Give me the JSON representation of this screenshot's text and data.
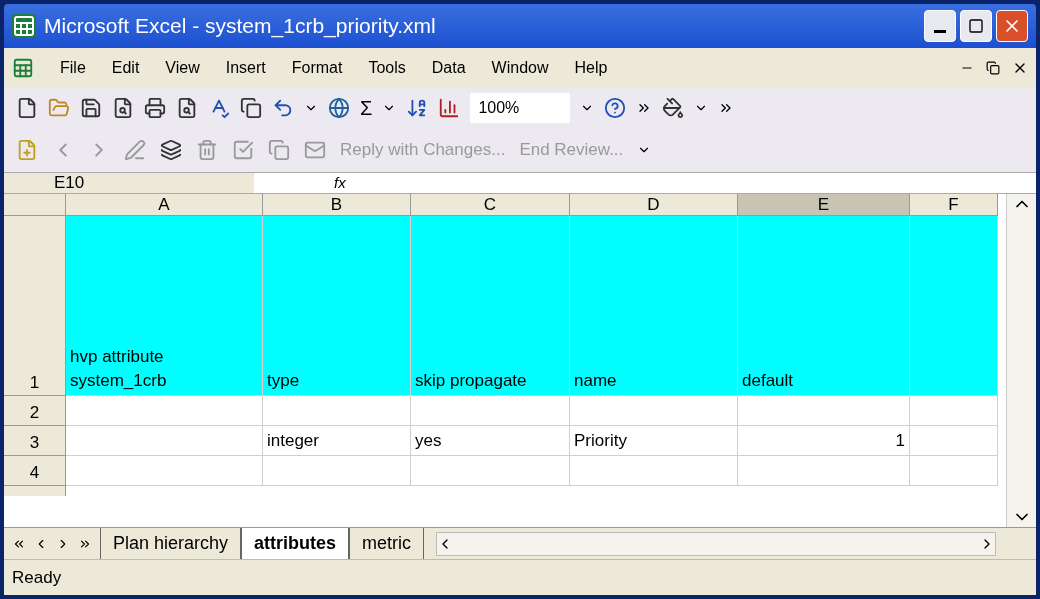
{
  "window": {
    "title": "Microsoft Excel - system_1crb_priority.xml"
  },
  "menu": [
    "File",
    "Edit",
    "View",
    "Insert",
    "Format",
    "Tools",
    "Data",
    "Window",
    "Help"
  ],
  "toolbar": {
    "sum": "Σ",
    "zoom": "100%"
  },
  "review_toolbar": {
    "reply": "Reply with Changes...",
    "end": "End Review..."
  },
  "formula_bar": {
    "name_box": "E10",
    "fx": "fx"
  },
  "columns": [
    {
      "label": "A",
      "selected": false
    },
    {
      "label": "B",
      "selected": false
    },
    {
      "label": "C",
      "selected": false
    },
    {
      "label": "D",
      "selected": false
    },
    {
      "label": "E",
      "selected": true
    },
    {
      "label": "F",
      "selected": false
    }
  ],
  "rows": [
    {
      "label": "1",
      "kind": "header",
      "cells": [
        "hvp attribute\nsystem_1crb",
        "type",
        "skip propagate",
        "name",
        "default",
        ""
      ]
    },
    {
      "label": "2",
      "kind": "plain",
      "cells": [
        "",
        "",
        "",
        "",
        "",
        ""
      ]
    },
    {
      "label": "3",
      "kind": "plain",
      "cells": [
        "",
        "integer",
        "yes",
        "Priority",
        "1",
        ""
      ]
    },
    {
      "label": "4",
      "kind": "plain",
      "cells": [
        "",
        "",
        "",
        "",
        "",
        ""
      ]
    }
  ],
  "sheet_tabs": [
    {
      "label": "Plan hierarchy",
      "selected": false
    },
    {
      "label": "attributes",
      "selected": true
    },
    {
      "label": "metric",
      "selected": false
    }
  ],
  "status_bar": {
    "text": "Ready"
  }
}
